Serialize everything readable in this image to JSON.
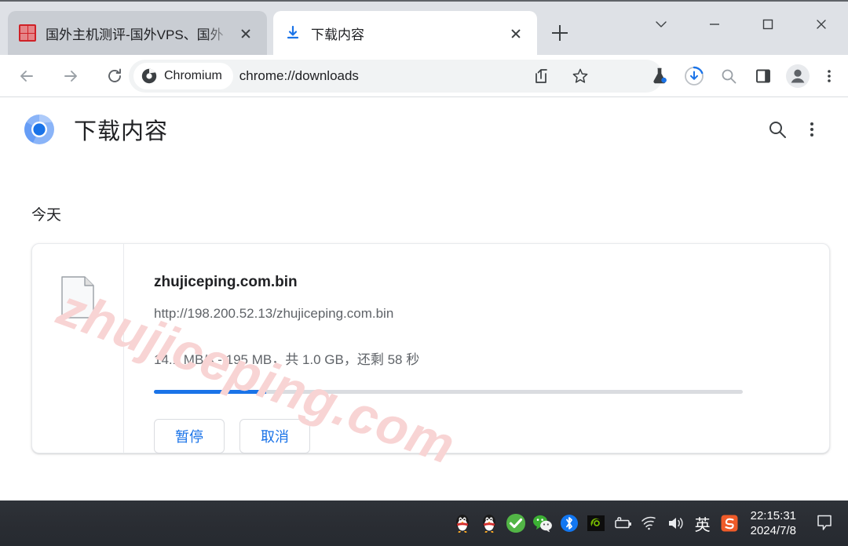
{
  "window": {
    "controls": [
      "tab-search",
      "minimize",
      "maximize",
      "close"
    ]
  },
  "tabs": [
    {
      "title": "国外主机测评-国外VPS、国外",
      "favicon": "site-seal-icon",
      "active": false,
      "close_label": "×"
    },
    {
      "title": "下载内容",
      "favicon": "download-icon",
      "active": true,
      "close_label": "×"
    }
  ],
  "newtab_label": "+",
  "toolbar": {
    "back": "back-arrow-icon",
    "forward": "forward-arrow-icon",
    "reload": "reload-icon",
    "chip_label": "Chromium",
    "url": "chrome://downloads",
    "share": "share-icon",
    "bookmark": "star-icon",
    "experiments": "flask-icon",
    "downloads": "download-progress-icon",
    "search": "search-icon",
    "side_panel": "side-panel-icon",
    "profile": "profile-avatar-icon",
    "menu": "three-dot-menu-icon"
  },
  "page": {
    "title": "下载内容",
    "logo": "chromium-logo",
    "search_icon": "search-icon",
    "menu_icon": "three-dot-menu-icon",
    "day_label": "今天",
    "watermark": "zhujiceping.com",
    "download": {
      "file_icon": "generic-file-icon",
      "file_name": "zhujiceping.com.bin",
      "file_url": "http://198.200.52.13/zhujiceping.com.bin",
      "status": "14.1 MB/s - 195 MB，共 1.0 GB，还剩 58 秒",
      "progress_percent": 19,
      "progress_color": "#1a73e8",
      "pause_label": "暂停",
      "cancel_label": "取消"
    }
  },
  "taskbar": {
    "tray_icons": [
      "qq-penguin-icon",
      "qq-penguin-icon",
      "security-check-icon",
      "wechat-icon",
      "bluetooth-icon",
      "nvidia-icon",
      "battery-icon",
      "wifi-icon",
      "volume-icon"
    ],
    "ime_label": "英",
    "sogou_icon": "sogou-icon",
    "time": "22:15:31",
    "date": "2024/7/8",
    "notification_icon": "notification-icon"
  },
  "colors": {
    "accent": "#1a73e8",
    "tabstrip_bg": "#dee1e6",
    "taskbar_bg": "#2a2d33",
    "watermark": "#f8d4d4"
  }
}
